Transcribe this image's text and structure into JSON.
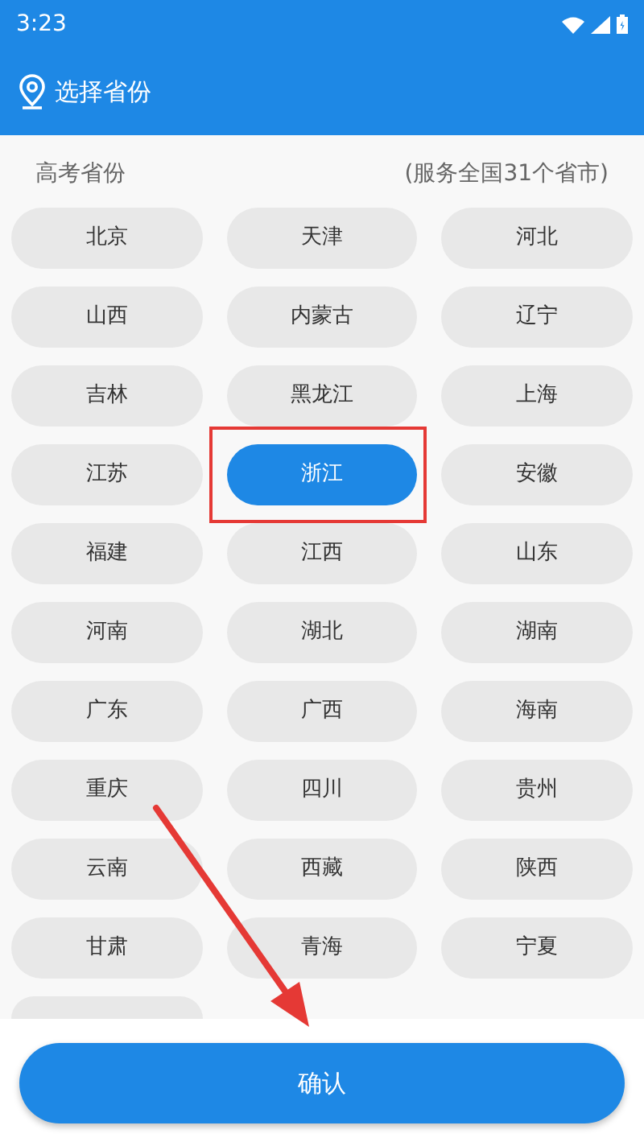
{
  "status_bar": {
    "time": "3:23"
  },
  "header": {
    "title": "选择省份"
  },
  "section": {
    "title": "高考省份",
    "note": "(服务全国31个省市)"
  },
  "provinces": [
    {
      "label": "北京",
      "selected": false,
      "outlined": false
    },
    {
      "label": "天津",
      "selected": false,
      "outlined": false
    },
    {
      "label": "河北",
      "selected": false,
      "outlined": false
    },
    {
      "label": "山西",
      "selected": false,
      "outlined": false
    },
    {
      "label": "内蒙古",
      "selected": false,
      "outlined": false
    },
    {
      "label": "辽宁",
      "selected": false,
      "outlined": false
    },
    {
      "label": "吉林",
      "selected": false,
      "outlined": false
    },
    {
      "label": "黑龙江",
      "selected": false,
      "outlined": false
    },
    {
      "label": "上海",
      "selected": false,
      "outlined": false
    },
    {
      "label": "江苏",
      "selected": false,
      "outlined": false
    },
    {
      "label": "浙江",
      "selected": true,
      "outlined": true
    },
    {
      "label": "安徽",
      "selected": false,
      "outlined": false
    },
    {
      "label": "福建",
      "selected": false,
      "outlined": false
    },
    {
      "label": "江西",
      "selected": false,
      "outlined": false
    },
    {
      "label": "山东",
      "selected": false,
      "outlined": false
    },
    {
      "label": "河南",
      "selected": false,
      "outlined": false
    },
    {
      "label": "湖北",
      "selected": false,
      "outlined": false
    },
    {
      "label": "湖南",
      "selected": false,
      "outlined": false
    },
    {
      "label": "广东",
      "selected": false,
      "outlined": false
    },
    {
      "label": "广西",
      "selected": false,
      "outlined": false
    },
    {
      "label": "海南",
      "selected": false,
      "outlined": false
    },
    {
      "label": "重庆",
      "selected": false,
      "outlined": false
    },
    {
      "label": "四川",
      "selected": false,
      "outlined": false
    },
    {
      "label": "贵州",
      "selected": false,
      "outlined": false
    },
    {
      "label": "云南",
      "selected": false,
      "outlined": false
    },
    {
      "label": "西藏",
      "selected": false,
      "outlined": false
    },
    {
      "label": "陕西",
      "selected": false,
      "outlined": false
    },
    {
      "label": "甘肃",
      "selected": false,
      "outlined": false
    },
    {
      "label": "青海",
      "selected": false,
      "outlined": false
    },
    {
      "label": "宁夏",
      "selected": false,
      "outlined": false
    }
  ],
  "confirm_button": {
    "label": "确认"
  }
}
